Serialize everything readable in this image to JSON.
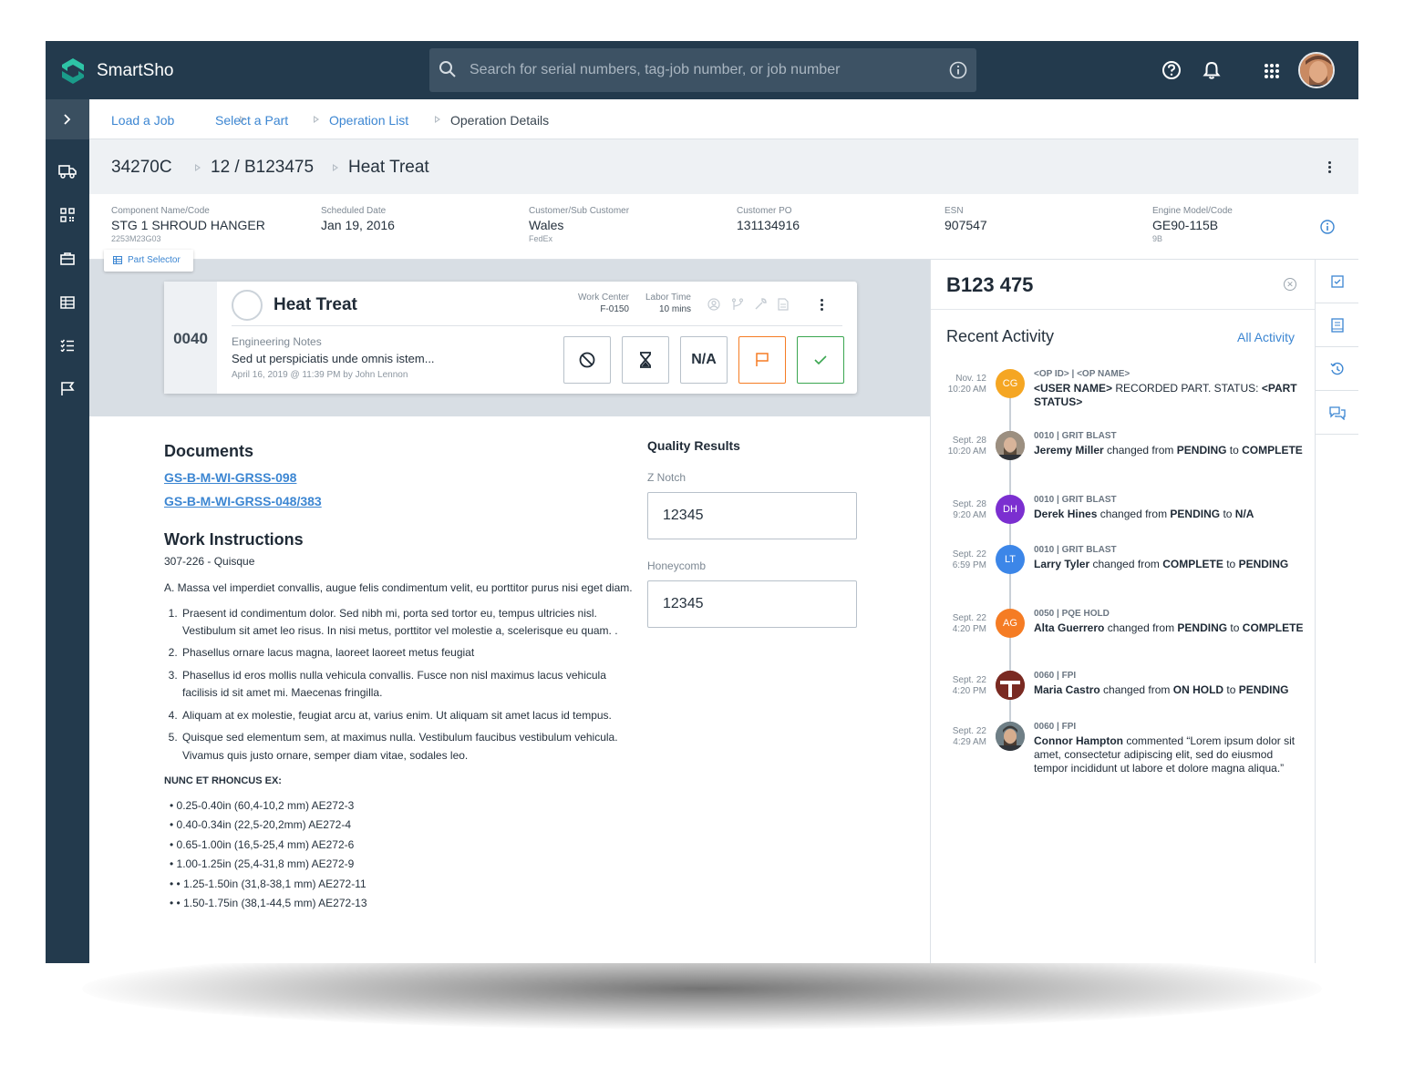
{
  "app": {
    "name": "SmartSho",
    "accent": "#3c86d2",
    "topbar_color": "#233a4d"
  },
  "search": {
    "placeholder": "Search for serial numbers, tag-job number, or job number"
  },
  "breadcrumb": [
    "Load a Job",
    "Select a Part",
    "Operation List",
    "Operation Details"
  ],
  "job": {
    "job_number": "34270C",
    "part": "12 / B123475",
    "operation": "Heat Treat"
  },
  "info": [
    {
      "label": "Component Name/Code",
      "value": "STG 1 SHROUD HANGER",
      "sub": "2253M23G03"
    },
    {
      "label": "Scheduled Date",
      "value": "Jan 19, 2016",
      "sub": ""
    },
    {
      "label": "Customer/Sub Customer",
      "value": "Wales",
      "sub": "FedEx"
    },
    {
      "label": "Customer PO",
      "value": "131134916",
      "sub": ""
    },
    {
      "label": "ESN",
      "value": "907547",
      "sub": ""
    },
    {
      "label": "Engine Model/Code",
      "value": "GE90-115B",
      "sub": "9B"
    }
  ],
  "part_selector": "Part Selector",
  "op_card": {
    "number": "0040",
    "title": "Heat Treat",
    "work_center_label": "Work Center",
    "work_center": "F-0150",
    "labor_time_label": "Labor Time",
    "labor_time": "10 mins",
    "notes_label": "Engineering Notes",
    "notes": "Sed ut perspiciatis unde omnis istem...",
    "notes_meta": "April 16, 2019 @ 11:39 PM by John Lennon",
    "na_label": "N/A",
    "flag_color": "#f57c24",
    "complete_color": "#3aa650"
  },
  "documents": {
    "title": "Documents",
    "links": [
      "GS-B-M-WI-GRSS-098",
      "GS-B-M-WI-GRSS-048/383"
    ]
  },
  "work_instructions": {
    "title": "Work Instructions",
    "subtitle": "307-226 - Quisque",
    "intro": "A.  Massa vel imperdiet convallis, augue felis condimentum velit, eu porttitor purus nisi eget diam.",
    "steps": [
      "Praesent id condimentum dolor. Sed nibh mi, porta sed tortor eu, tempus ultricies nisl. Vestibulum sit amet leo risus. In nisi metus, porttitor vel molestie a, scelerisque eu quam. .",
      "Phasellus ornare lacus magna, laoreet laoreet metus feugiat",
      "Phasellus id eros mollis nulla vehicula convallis. Fusce non nisl maximus lacus vehicula facilisis id sit amet mi. Maecenas fringilla.",
      "Aliquam at ex molestie, feugiat arcu at, varius enim. Ut aliquam sit amet lacus id tempus.",
      "Quisque sed elementum sem, at maximus nulla. Vestibulum faucibus vestibulum vehicula. Vivamus quis justo ornare, semper diam vitae, sodales leo."
    ],
    "subhead": "NUNC ET RHONCUS EX:",
    "bullets": [
      "0.25-0.40in (60,4-10,2 mm) AE272-3",
      "0.40-0.34in (22,5-20,2mm)  AE272-4",
      "0.65-1.00in (16,5-25,4 mm) AE272-6",
      "1.00-1.25in (25,4-31,8 mm) AE272-9",
      "•  1.25-1.50in (31,8-38,1 mm) AE272-11",
      "•  1.50-1.75in (38,1-44,5 mm) AE272-13"
    ]
  },
  "quality": {
    "title": "Quality Results",
    "fields": [
      {
        "label": "Z Notch",
        "value": "12345"
      },
      {
        "label": "Honeycomb",
        "value": "12345"
      }
    ]
  },
  "panel": {
    "title": "B123 475",
    "heading": "Recent Activity",
    "all_link": "All Activity",
    "activities": [
      {
        "date": "Nov. 12",
        "time": "10:20 AM",
        "initials": "CG",
        "color": "#f5a623",
        "head": "<OP ID> | <OP NAME>",
        "name": "<USER NAME>",
        "text1": " RECORDED PART. STATUS: ",
        "b1": "<PART STATUS>",
        "text2": "",
        "b2": ""
      },
      {
        "date": "Sept. 28",
        "time": "10:20 AM",
        "initials": "",
        "color": "#8a7a6a",
        "head": "0010 | GRIT BLAST",
        "name": "Jeremy Miller",
        "text1": " changed from ",
        "b1": "PENDING",
        "text2": " to ",
        "b2": "COMPLETE"
      },
      {
        "date": "Sept. 28",
        "time": "9:20 AM",
        "initials": "DH",
        "color": "#7b2fd0",
        "head": "0010 | GRIT BLAST",
        "name": "Derek Hines",
        "text1": " changed from ",
        "b1": "PENDING",
        "text2": " to ",
        "b2": "N/A"
      },
      {
        "date": "Sept. 22",
        "time": "6:59  PM",
        "initials": "LT",
        "color": "#3c86e8",
        "head": "0010 | GRIT BLAST",
        "name": "Larry Tyler",
        "text1": " changed from ",
        "b1": "COMPLETE",
        "text2": " to ",
        "b2": "PENDING"
      },
      {
        "date": "Sept. 22",
        "time": "4:20 PM",
        "initials": "AG",
        "color": "#f57c24",
        "head": "0050 | PQE HOLD",
        "name": "Alta Guerrero",
        "text1": " changed from ",
        "b1": "PENDING",
        "text2": " to ",
        "b2": "COMPLETE"
      },
      {
        "date": "Sept. 22",
        "time": "4:20 PM",
        "initials": "",
        "color": "#7a2a22",
        "head": "0060 | FPI",
        "name": "Maria Castro",
        "text1": " changed from ",
        "b1": "ON HOLD",
        "text2": " to ",
        "b2": "PENDING"
      },
      {
        "date": "Sept. 22",
        "time": "4:29 AM",
        "initials": "",
        "color": "#5a6a72",
        "head": "0060 | FPI",
        "name": "Connor Hampton",
        "text1": " commented “Lorem ipsum dolor sit amet, consectetur adipiscing elit, sed do eiusmod tempor incididunt ut labore et dolore magna aliqua.”",
        "b1": "",
        "text2": "",
        "b2": ""
      }
    ]
  }
}
